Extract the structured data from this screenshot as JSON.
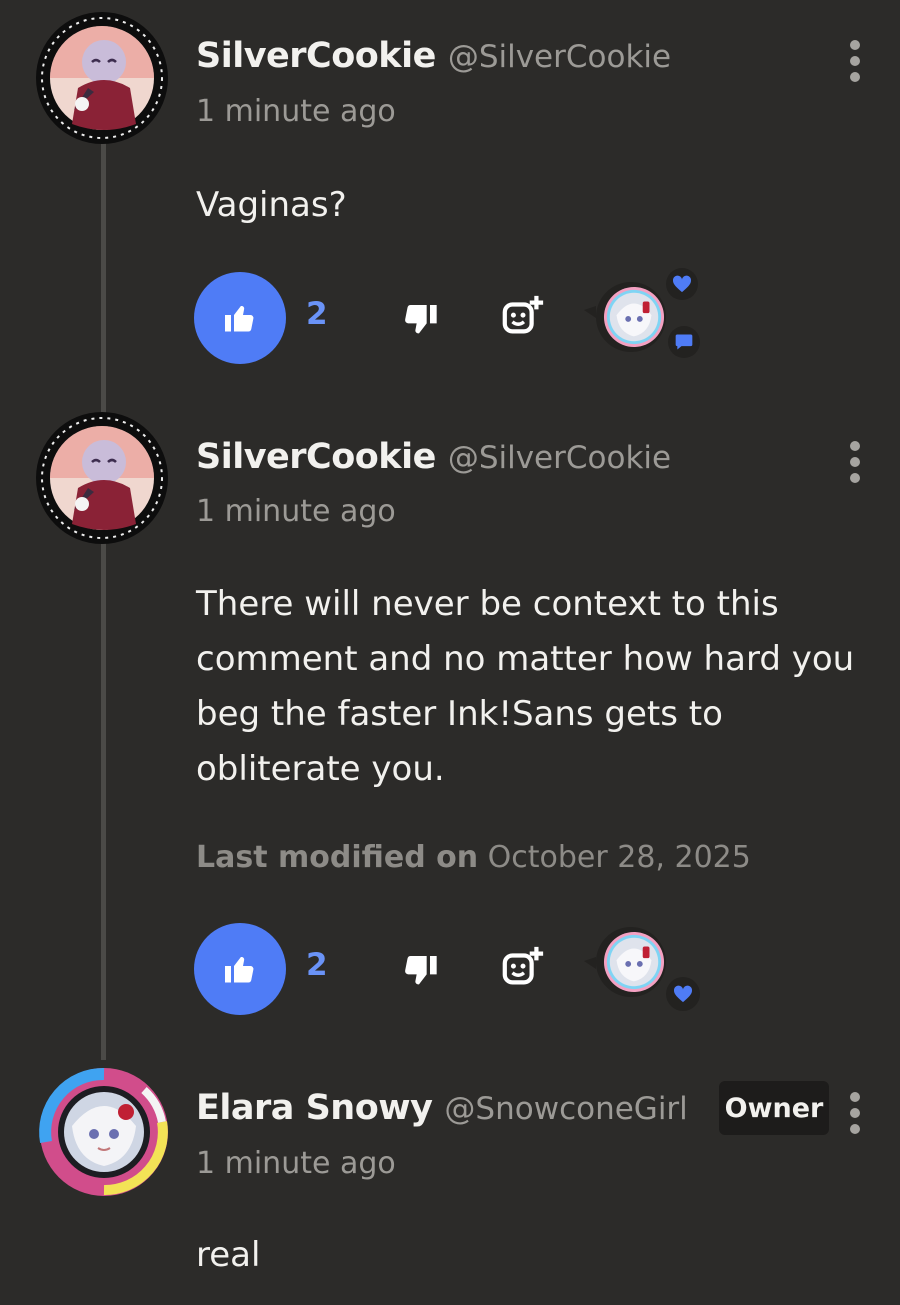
{
  "comments": [
    {
      "display_name": "SilverCookie",
      "handle": "@SilverCookie",
      "timestamp": "1 minute ago",
      "body": "Vaginas?",
      "like_count": "2",
      "avatar": "avatar-silvercookie"
    },
    {
      "display_name": "SilverCookie",
      "handle": "@SilverCookie",
      "timestamp": "1 minute ago",
      "body": "There will never be context to this comment and no matter how hard you beg the faster Ink!Sans gets to obliterate you.",
      "modified_label": "Last modified on",
      "modified_date": "October 28, 2025",
      "like_count": "2",
      "avatar": "avatar-silvercookie"
    },
    {
      "display_name": "Elara Snowy",
      "handle": "@SnowconeGirl",
      "badge": "Owner",
      "timestamp": "1 minute ago",
      "body": "real",
      "avatar": "avatar-elara"
    }
  ],
  "icons": {
    "like": "thumbs-up-icon",
    "dislike": "thumbs-down-icon",
    "react": "add-reaction-icon",
    "menu": "more-vertical-icon",
    "heart": "heart-icon",
    "reply": "chat-bubble-icon"
  },
  "colors": {
    "background": "#2c2b29",
    "accent": "#4f7cf6",
    "like_count": "#6a93f7",
    "muted_text": "#9c9a96",
    "badge_bg": "#1d1c1b"
  }
}
